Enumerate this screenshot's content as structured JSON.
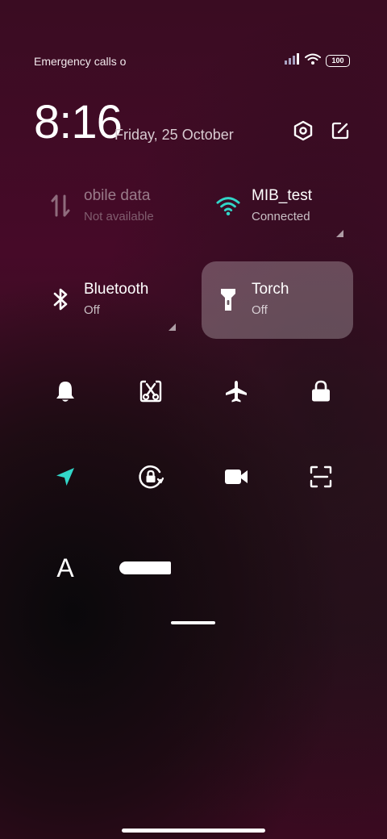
{
  "status": {
    "carrier": "Emergency calls o",
    "battery": "100",
    "icons": [
      "signal-icon",
      "wifi-icon",
      "battery-icon"
    ]
  },
  "header": {
    "time": "8:16",
    "date": "Friday, 25 October",
    "actions": [
      "settings-icon",
      "edit-icon"
    ]
  },
  "tiles": {
    "mobile": {
      "title": "obile data",
      "status": "Not available",
      "icon": "mobile-data-icon"
    },
    "wifi": {
      "title": "MIB_test",
      "status": "Connected",
      "icon": "wifi-icon"
    },
    "bluetooth": {
      "title": "Bluetooth",
      "status": "Off",
      "icon": "bluetooth-icon"
    },
    "torch": {
      "title": "Torch",
      "status": "Off",
      "icon": "torch-icon"
    }
  },
  "small_tiles_row1": [
    "bell-icon",
    "screenshot-icon",
    "airplane-icon",
    "lock-icon"
  ],
  "small_tiles_row2": [
    "location-icon",
    "rotation-lock-icon",
    "video-icon",
    "scan-icon"
  ],
  "font_tile": "A",
  "colors": {
    "accent": "#32d6c8",
    "active_tile": "rgba(255,255,255,0.26)"
  }
}
